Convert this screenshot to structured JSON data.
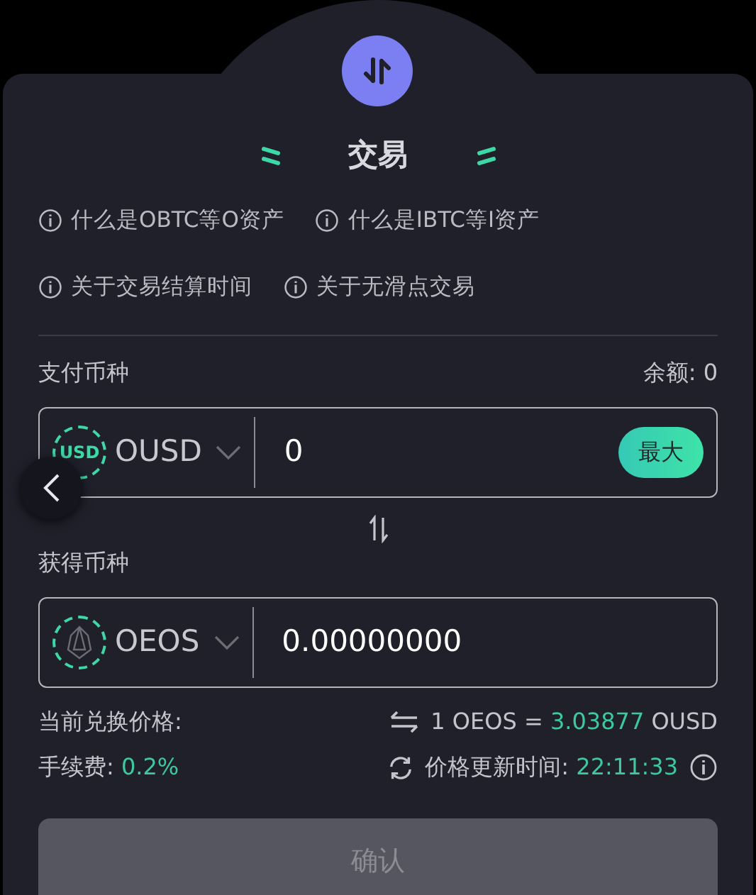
{
  "header": {
    "title": "交易"
  },
  "info_links": [
    {
      "text": "什么是OBTC等O资产"
    },
    {
      "text": "什么是IBTC等I资产"
    },
    {
      "text": "关于交易结算时间"
    },
    {
      "text": "关于无滑点交易"
    }
  ],
  "pay": {
    "label": "支付币种",
    "balance": "余额: 0",
    "coin_badge": "USD",
    "currency": "OUSD",
    "amount": "0",
    "max_button": "最大"
  },
  "receive": {
    "label": "获得币种",
    "currency": "OEOS",
    "amount": "0.00000000"
  },
  "rate": {
    "label": "当前兑换价格:",
    "prefix": "1 OEOS = ",
    "value": "3.03877",
    "suffix": " OUSD"
  },
  "fee": {
    "label": "手续费: ",
    "value": "0.2%"
  },
  "update": {
    "label": "价格更新时间: ",
    "time": "22:11:33"
  },
  "confirm": {
    "label": "确认",
    "disabled": true
  }
}
